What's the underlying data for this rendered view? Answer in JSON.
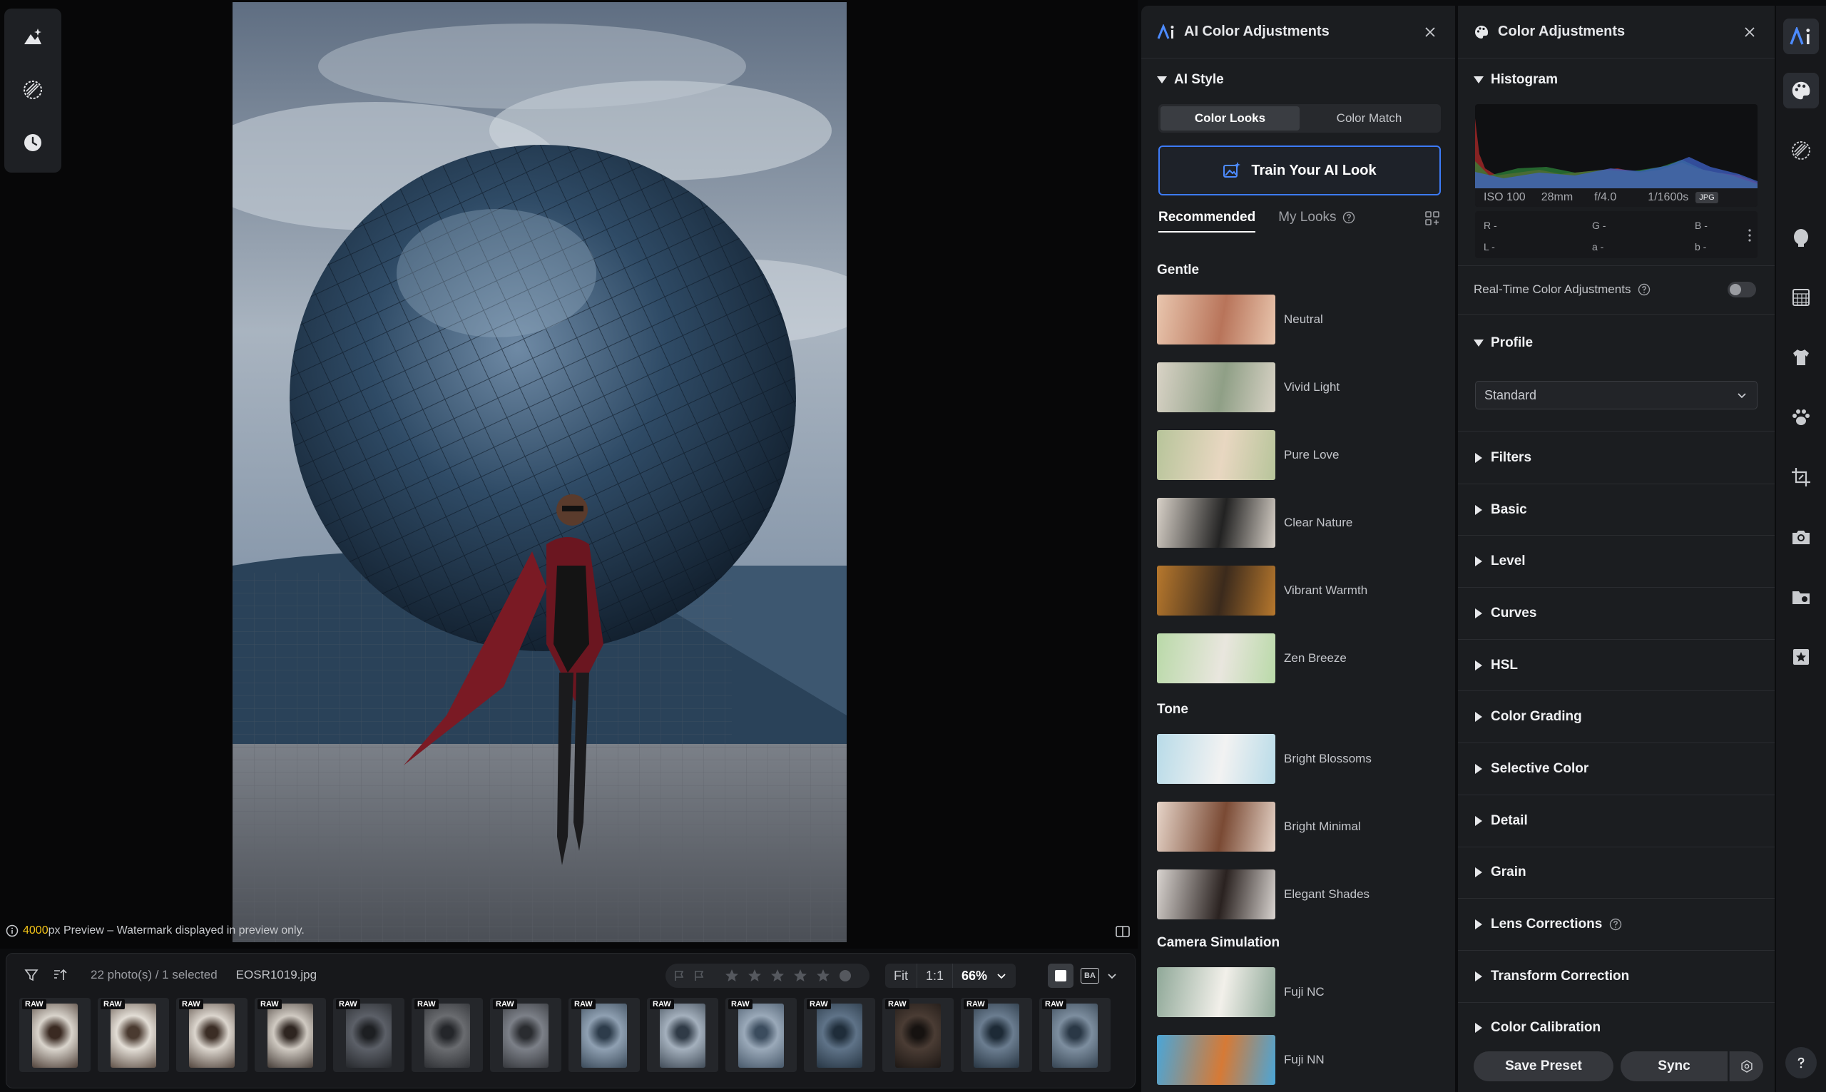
{
  "canvas": {
    "preview_note_px": "4000",
    "preview_note_rest": "px Preview – Watermark displayed in preview only."
  },
  "filmstrip": {
    "count_text": "22 photo(s) / 1 selected",
    "file_name": "EOSR1019.jpg",
    "zoom_fit": "Fit",
    "zoom_1to1": "1:1",
    "zoom_percent": "66%",
    "raw_badge": "RAW",
    "thumb_count": 14,
    "view_compare_label": "BA"
  },
  "ai_panel": {
    "title": "AI Color Adjustments",
    "ai_style_heading": "AI Style",
    "segments": [
      "Color Looks",
      "Color Match"
    ],
    "active_segment": "Color Looks",
    "train_button": "Train Your AI Look",
    "tabs": [
      "Recommended",
      "My Looks"
    ],
    "groups": [
      {
        "name": "Gentle",
        "looks": [
          "Neutral",
          "Vivid Light",
          "Pure Love",
          "Clear Nature",
          "Vibrant Warmth",
          "Zen Breeze"
        ]
      },
      {
        "name": "Tone",
        "looks": [
          "Bright Blossoms",
          "Bright Minimal",
          "Elegant Shades"
        ]
      },
      {
        "name": "Camera Simulation",
        "looks": [
          "Fuji NC",
          "Fuji NN"
        ]
      }
    ]
  },
  "color_panel": {
    "title": "Color Adjustments",
    "histogram_heading": "Histogram",
    "exif": {
      "iso": "ISO 100",
      "focal": "28mm",
      "aperture": "f/4.0",
      "shutter": "1/1600s",
      "format": "JPG"
    },
    "pixel_values": {
      "r": "R -",
      "g": "G -",
      "b": "B -",
      "l": "L -",
      "a": "a -",
      "bb": "b -"
    },
    "realtime_label": "Real-Time Color Adjustments",
    "realtime_on": false,
    "profile_heading": "Profile",
    "profile_value": "Standard",
    "sections": [
      "Filters",
      "Basic",
      "Level",
      "Curves",
      "HSL",
      "Color Grading",
      "Selective Color",
      "Detail",
      "Grain",
      "Lens Corrections",
      "Transform Correction",
      "Color Calibration"
    ],
    "save_preset": "Save Preset",
    "sync": "Sync"
  },
  "colors": {
    "accent": "#3d7bf7",
    "panel_bg": "#1b1d20",
    "rail_active": "#2a2d33"
  }
}
